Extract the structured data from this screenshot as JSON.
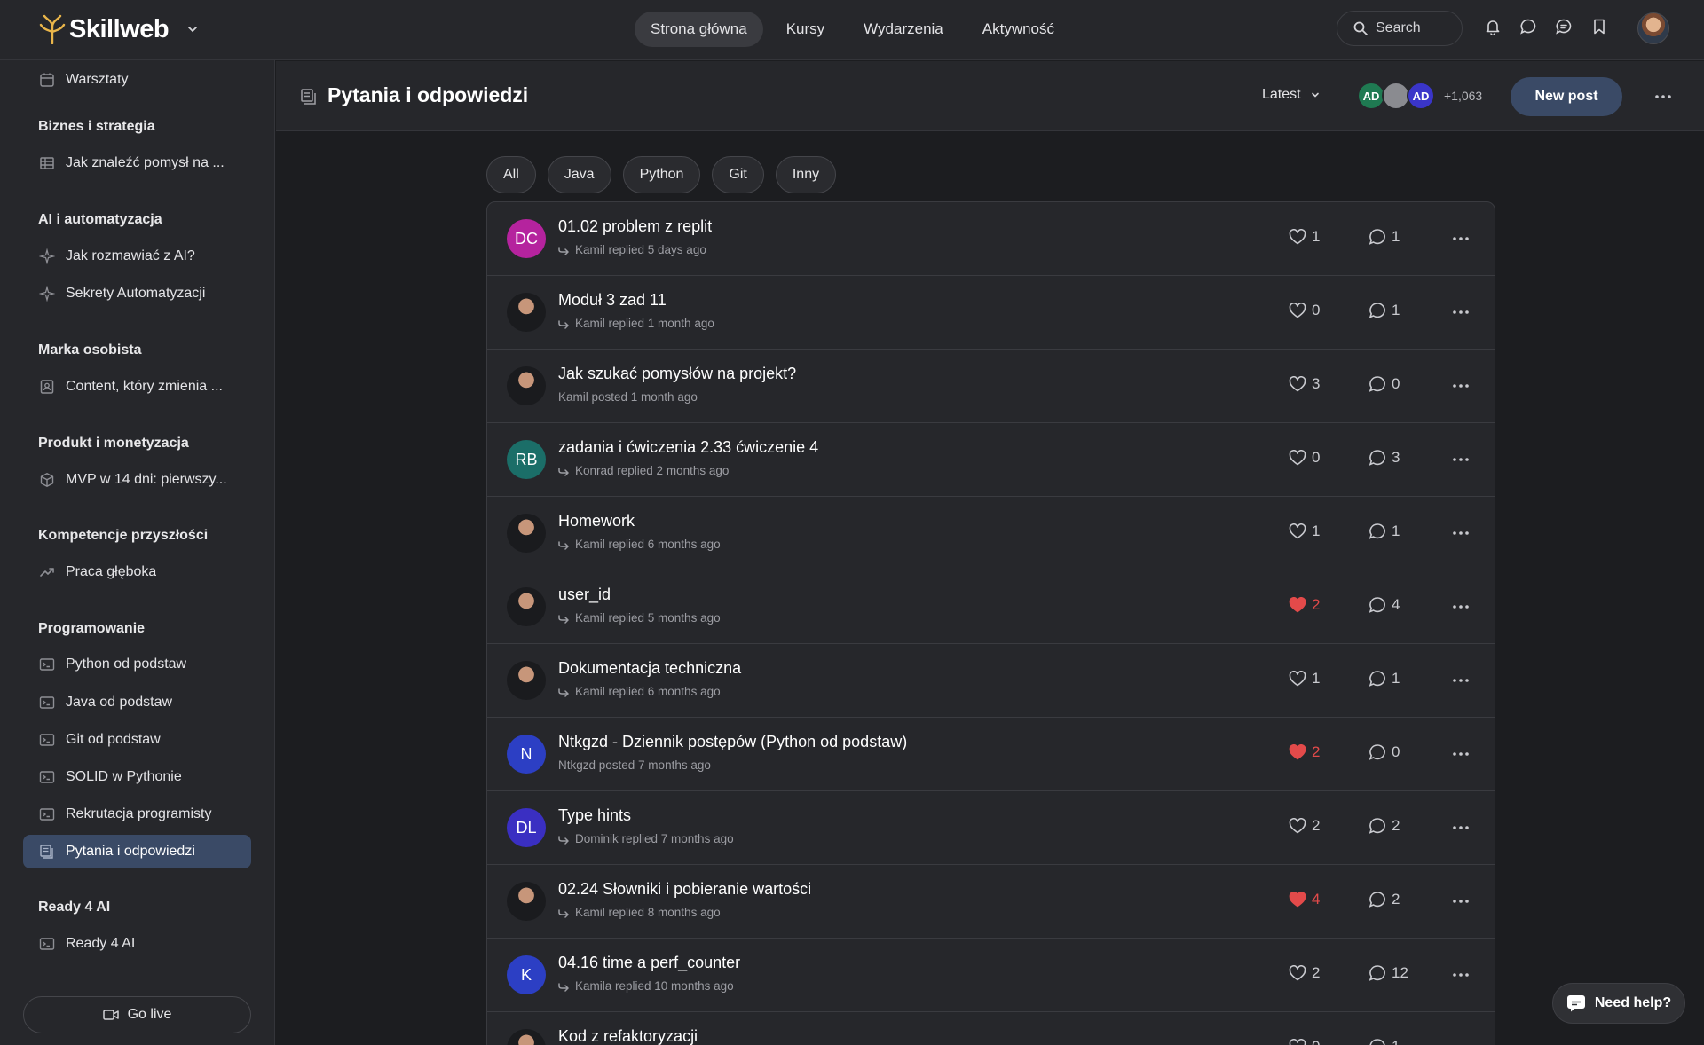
{
  "app": {
    "name": "Skillweb"
  },
  "nav": {
    "items": [
      "Strona główna",
      "Kursy",
      "Wydarzenia",
      "Aktywność"
    ],
    "active": 0
  },
  "search": {
    "label": "Search"
  },
  "sidebar": {
    "items_top": [
      {
        "label": "Warsztaty",
        "icon": "calendar-icon"
      }
    ],
    "sections": [
      {
        "title": "Biznes i strategia",
        "items": [
          {
            "label": "Jak znaleźć pomysł na ...",
            "icon": "table-icon"
          }
        ]
      },
      {
        "title": "AI i automatyzacja",
        "items": [
          {
            "label": "Jak rozmawiać z AI?",
            "icon": "sparkle-icon"
          },
          {
            "label": "Sekrety Automatyzacji",
            "icon": "sparkle-icon"
          }
        ]
      },
      {
        "title": "Marka osobista",
        "items": [
          {
            "label": "Content, który zmienia ...",
            "icon": "profile-card-icon"
          }
        ]
      },
      {
        "title": "Produkt i monetyzacja",
        "items": [
          {
            "label": "MVP w 14 dni: pierwszy...",
            "icon": "cube-icon"
          }
        ]
      },
      {
        "title": "Kompetencje przyszłości",
        "items": [
          {
            "label": "Praca głęboka",
            "icon": "trend-icon"
          }
        ]
      },
      {
        "title": "Programowanie",
        "items": [
          {
            "label": "Python od podstaw",
            "icon": "terminal-icon"
          },
          {
            "label": "Java od podstaw",
            "icon": "terminal-icon"
          },
          {
            "label": "Git od podstaw",
            "icon": "terminal-icon"
          },
          {
            "label": "SOLID w Pythonie",
            "icon": "terminal-icon"
          },
          {
            "label": "Rekrutacja programisty",
            "icon": "terminal-icon"
          },
          {
            "label": "Pytania i odpowiedzi",
            "icon": "forum-icon",
            "active": true
          }
        ]
      },
      {
        "title": "Ready 4 AI",
        "items": [
          {
            "label": "Ready 4 AI",
            "icon": "terminal-icon"
          }
        ]
      }
    ],
    "go_live": "Go live"
  },
  "page": {
    "title": "Pytania i odpowiedzi",
    "sort": "Latest",
    "members": [
      {
        "initials": "AD",
        "color": "#1f7a52"
      },
      {
        "initials": "",
        "color": "#8a8b90"
      },
      {
        "initials": "AD",
        "color": "#3a35c9"
      }
    ],
    "member_count": "+1,063",
    "new_post": "New post"
  },
  "filters": [
    "All",
    "Java",
    "Python",
    "Git",
    "Inny"
  ],
  "posts": [
    {
      "title": "01.02 problem z replit",
      "meta": "Kamil replied 5 days ago",
      "reply": true,
      "likes": 1,
      "liked": false,
      "comments": 1,
      "avatar": {
        "initials": "DC",
        "color": "#b5239e"
      }
    },
    {
      "title": "Moduł 3 zad 11",
      "meta": "Kamil replied 1 month ago",
      "reply": true,
      "likes": 0,
      "liked": false,
      "comments": 1,
      "avatar": {
        "initials": "",
        "color": "#5a4a3a"
      }
    },
    {
      "title": "Jak szukać pomysłów na projekt?",
      "meta": "Kamil posted 1 month ago",
      "reply": false,
      "likes": 3,
      "liked": false,
      "comments": 0,
      "avatar": {
        "initials": "",
        "color": "#b98a6a"
      }
    },
    {
      "title": "zadania i ćwiczenia 2.33 ćwiczenie 4",
      "meta": "Konrad replied 2 months ago",
      "reply": true,
      "likes": 0,
      "liked": false,
      "comments": 3,
      "avatar": {
        "initials": "RB",
        "color": "#1b6e68"
      }
    },
    {
      "title": "Homework",
      "meta": "Kamil replied 6 months ago",
      "reply": true,
      "likes": 1,
      "liked": false,
      "comments": 1,
      "avatar": {
        "initials": "",
        "color": "#2e2f33"
      }
    },
    {
      "title": "user_id",
      "meta": "Kamil replied 5 months ago",
      "reply": true,
      "likes": 2,
      "liked": true,
      "comments": 4,
      "avatar": {
        "initials": "",
        "color": "#2e2f33"
      }
    },
    {
      "title": "Dokumentacja techniczna",
      "meta": "Kamil replied 6 months ago",
      "reply": true,
      "likes": 1,
      "liked": false,
      "comments": 1,
      "avatar": {
        "initials": "",
        "color": "#2e2f33"
      }
    },
    {
      "title": "Ntkgzd - Dziennik postępów (Python od podstaw)",
      "meta": "Ntkgzd posted 7 months ago",
      "reply": false,
      "likes": 2,
      "liked": true,
      "comments": 0,
      "avatar": {
        "initials": "N",
        "color": "#2c3fc4"
      }
    },
    {
      "title": "Type hints",
      "meta": "Dominik replied 7 months ago",
      "reply": true,
      "likes": 2,
      "liked": false,
      "comments": 2,
      "avatar": {
        "initials": "DL",
        "color": "#3a2fc2"
      }
    },
    {
      "title": "02.24 Słowniki i pobieranie wartości",
      "meta": "Kamil replied 8 months ago",
      "reply": true,
      "likes": 4,
      "liked": true,
      "comments": 2,
      "avatar": {
        "initials": "",
        "color": "#2e2f33"
      }
    },
    {
      "title": "04.16 time a perf_counter",
      "meta": "Kamila replied 10 months ago",
      "reply": true,
      "likes": 2,
      "liked": false,
      "comments": 12,
      "avatar": {
        "initials": "K",
        "color": "#2c3fc4"
      }
    },
    {
      "title": "Kod z refaktoryzacji",
      "meta": "",
      "reply": false,
      "likes": 0,
      "liked": false,
      "comments": 1,
      "avatar": {
        "initials": "",
        "color": "#b5239e"
      }
    }
  ],
  "help": "Need help?"
}
